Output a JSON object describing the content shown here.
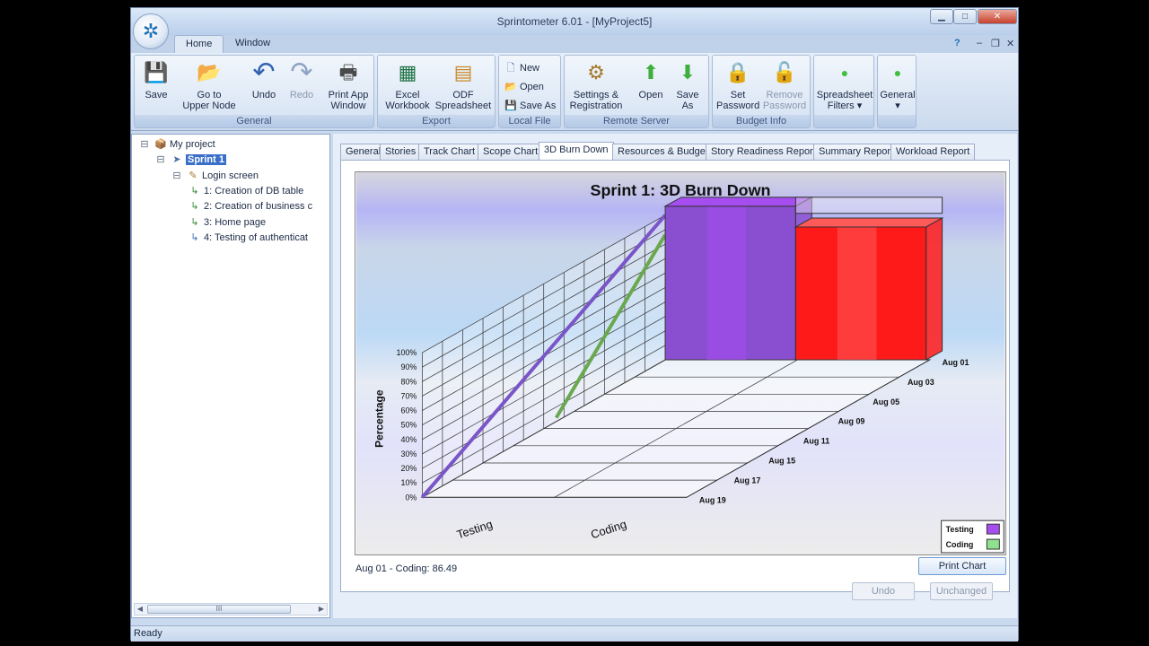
{
  "window": {
    "title": "Sprintometer 6.01 - [MyProject5]",
    "buttons": {
      "minimize": "▁",
      "maximize": "□",
      "close": "✕"
    }
  },
  "app_tabs": [
    "Home",
    "Window"
  ],
  "mdi_controls": {
    "help": "?",
    "minimize": "–",
    "restore": "❐",
    "close": "✕"
  },
  "ribbon": {
    "groups": [
      {
        "label": "General",
        "buttons": [
          {
            "label": "Save",
            "icon": "floppy-icon",
            "glyph": "💾"
          },
          {
            "label": "Go to\nUpper Node",
            "icon": "folder-up-icon",
            "glyph": "📂"
          },
          {
            "label": "Undo",
            "icon": "undo-icon",
            "glyph": "↶"
          },
          {
            "label": "Redo",
            "icon": "redo-icon",
            "glyph": "↷",
            "disabled": true
          },
          {
            "label": "Print App\nWindow",
            "icon": "printer-icon",
            "glyph": "🖶"
          }
        ]
      },
      {
        "label": "Export",
        "buttons": [
          {
            "label": "Excel\nWorkbook",
            "icon": "excel-icon",
            "glyph": "▦"
          },
          {
            "label": "ODF\nSpreadsheet",
            "icon": "spreadsheet-icon",
            "glyph": "▤"
          }
        ]
      },
      {
        "label": "Local File",
        "buttons": [
          {
            "label": "New",
            "icon": "new-file-icon",
            "glyph": "🗋"
          },
          {
            "label": "Open",
            "icon": "open-folder-icon",
            "glyph": "📂"
          },
          {
            "label": "Save As",
            "icon": "save-as-icon",
            "glyph": "💾"
          }
        ]
      },
      {
        "label": "Remote Server",
        "buttons": [
          {
            "label": "Settings &\nRegistration",
            "icon": "settings-icon",
            "glyph": "⚙"
          },
          {
            "label": "Open",
            "icon": "download-arrow-icon",
            "glyph": "⬆"
          },
          {
            "label": "Save\nAs",
            "icon": "upload-arrow-icon",
            "glyph": "⬇"
          }
        ]
      },
      {
        "label": "Budget Info",
        "buttons": [
          {
            "label": "Set\nPassword",
            "icon": "lock-icon",
            "glyph": "🔒"
          },
          {
            "label": "Remove\nPassword",
            "icon": "unlock-icon",
            "glyph": "🔓",
            "disabled": true
          }
        ]
      },
      {
        "label": "",
        "buttons": [
          {
            "label": "Spreadsheet\nFilters ▾",
            "icon": "green-dot-icon",
            "glyph": "●"
          }
        ]
      },
      {
        "label": "",
        "buttons": [
          {
            "label": "General\n▾",
            "icon": "green-dot-icon",
            "glyph": "●"
          }
        ]
      }
    ]
  },
  "tree": {
    "nodes": [
      {
        "label": "My project",
        "icon": "project-icon",
        "glyph": "📦",
        "expander": "⊟"
      },
      {
        "label": "Sprint 1",
        "icon": "sprint-icon",
        "glyph": "➤",
        "expander": "⊟",
        "selected": true
      },
      {
        "label": "Login screen",
        "icon": "story-icon",
        "glyph": "✎",
        "expander": "⊟"
      },
      {
        "label": "1: Creation of DB table",
        "icon": "task-icon",
        "glyph": "↳"
      },
      {
        "label": "2: Creation of business c",
        "icon": "task-icon",
        "glyph": "↳"
      },
      {
        "label": "3: Home page",
        "icon": "task-icon",
        "glyph": "↳"
      },
      {
        "label": "4: Testing of authenticat",
        "icon": "task-icon",
        "glyph": "↳"
      }
    ],
    "scroll_thumb": "III"
  },
  "content_tabs": [
    "General",
    "Stories",
    "Track Chart",
    "Scope Chart",
    "3D Burn Down",
    "Resources & Budget",
    "Story Readiness Report",
    "Summary Report",
    "Workload Report"
  ],
  "active_tab": "3D Burn Down",
  "chart_status": "Aug 01 - Coding: 86.49",
  "print_chart_label": "Print Chart",
  "footer": {
    "undo": "Undo",
    "unchanged": "Unchanged"
  },
  "status": "Ready",
  "colors": {
    "testing": "#a64df0",
    "coding": "#8fe08f",
    "testing_line": "#7a55c8",
    "coding_line": "#6aa84f",
    "bar_red": "#ff1a1a",
    "bar_purple": "#8a4fd0"
  },
  "chart_data": {
    "type": "bar",
    "title": "Sprint 1: 3D Burn Down",
    "ylabel": "Percentage",
    "yticks": [
      "0%",
      "10%",
      "20%",
      "30%",
      "40%",
      "50%",
      "60%",
      "70%",
      "80%",
      "90%",
      "100%"
    ],
    "ylim": [
      0,
      100
    ],
    "categories": [
      "Testing",
      "Coding"
    ],
    "dates": [
      "Aug 01",
      "Aug 03",
      "Aug 05",
      "Aug 09",
      "Aug 11",
      "Aug 15",
      "Aug 17",
      "Aug 19"
    ],
    "series": [
      {
        "name": "Testing",
        "values": [
          100
        ]
      },
      {
        "name": "Coding",
        "values": [
          86.49
        ]
      }
    ],
    "legend_position": "bottom-right"
  }
}
